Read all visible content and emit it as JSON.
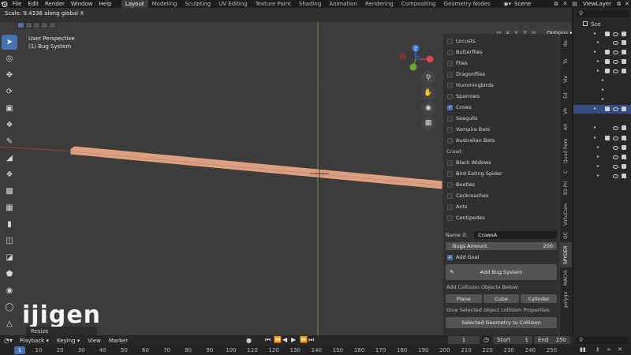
{
  "menu": {
    "items": [
      "File",
      "Edit",
      "Render",
      "Window",
      "Help"
    ]
  },
  "workspaces": [
    "Layout",
    "Modeling",
    "Sculpting",
    "UV Editing",
    "Texture Paint",
    "Shading",
    "Animation",
    "Rendering",
    "Compositing",
    "Geometry Nodes"
  ],
  "active_workspace": "Layout",
  "scene_name": "Scene",
  "view_layer": "ViewLayer",
  "viewport": {
    "operator_status": "Scale: 9.4336 along global X",
    "view_name": "User Perspective",
    "collection_info": "(1) Bug System",
    "options_label": "Options",
    "axis_x": "X",
    "axis_y": "Y",
    "axis_z": "Z"
  },
  "bug_panel": {
    "fly_items": [
      {
        "label": "Locusts",
        "checked": false
      },
      {
        "label": "Butterflies",
        "checked": false
      },
      {
        "label": "Flies",
        "checked": false
      },
      {
        "label": "Dragonflies",
        "checked": false
      },
      {
        "label": "Hummingbirds",
        "checked": false
      },
      {
        "label": "Sparrows",
        "checked": false
      },
      {
        "label": "Crows",
        "checked": true
      },
      {
        "label": "Seagulls",
        "checked": false
      },
      {
        "label": "Vampire Bats",
        "checked": false
      },
      {
        "label": "Australian Bats",
        "checked": false
      }
    ],
    "crawl_label": "Crawl:",
    "crawl_items": [
      {
        "label": "Black Widows",
        "checked": false
      },
      {
        "label": "Bird Eating Spider",
        "checked": false
      },
      {
        "label": "Beetles",
        "checked": false
      },
      {
        "label": "Cockroaches",
        "checked": false
      },
      {
        "label": "Ants",
        "checked": false
      },
      {
        "label": "Centipedes",
        "checked": false
      }
    ],
    "name_label": "Name it:",
    "name_value": "CrowsA",
    "bugs_amount_label": "Bugs Amount",
    "bugs_amount_value": "200",
    "add_goal_label": "Add Goal",
    "add_goal_checked": true,
    "add_bug_system_label": "Add Bug System",
    "collision_label": "Add Collision Objects Below:",
    "collision_buttons": [
      "Plane",
      "Cube",
      "Cylinder"
    ],
    "give_selected_label": "Give Selected object collision Properties:",
    "selected_geometry_label": "Selected Geometry to Collision"
  },
  "side_tabs": [
    "Ite",
    "To",
    "Vie",
    "Ed",
    "VR",
    "AR",
    "Quad Rem",
    "C",
    "3D-Pri",
    "VirtuCam",
    "OC",
    "SPYDER",
    "MACHI",
    "polygo"
  ],
  "active_side_tab": "SPYDER",
  "outliner": {
    "first_row": "Sce"
  },
  "timeline": {
    "menus": [
      "Playback",
      "Keying",
      "View",
      "Marker"
    ],
    "current_frame": "1",
    "start_label": "Start",
    "start_value": "1",
    "end_label": "End",
    "end_value": "250",
    "ruler_ticks": [
      "10",
      "20",
      "30",
      "40",
      "50",
      "60",
      "70",
      "80",
      "90",
      "100",
      "110",
      "120",
      "130",
      "140",
      "150",
      "160",
      "170",
      "180",
      "190",
      "200",
      "210",
      "220",
      "230",
      "240",
      "250"
    ],
    "current_tick": "1"
  },
  "watermark": "ijigen",
  "resize_panel_label": "Resize",
  "colors": {
    "accent": "#4772b3",
    "viewport_bg": "#3c3c3c",
    "object_fill": "#d9a083"
  }
}
